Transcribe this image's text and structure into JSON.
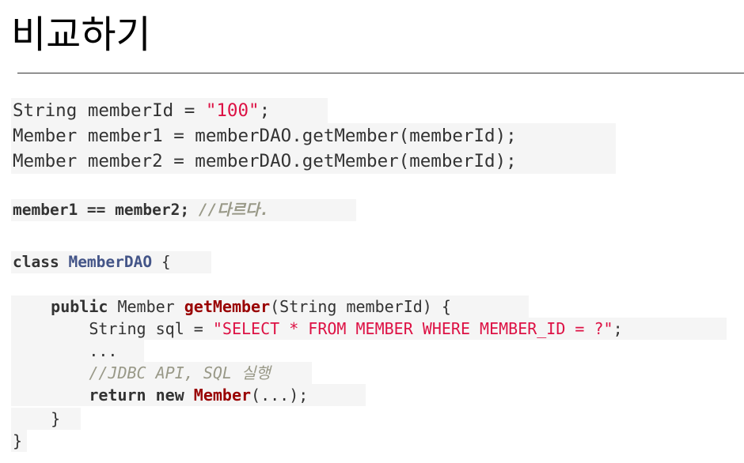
{
  "page": {
    "title": "비교하기"
  },
  "code": {
    "line1": {
      "p1": "String memberId = ",
      "s1": "\"100\"",
      "p2": ";"
    },
    "line2": {
      "p1": "Member member1 = memberDAO.getMember(memberId);"
    },
    "line3": {
      "p1": "Member member2 = memberDAO.getMember(memberId);"
    },
    "line4": {
      "p1": "member1 == member2;",
      "c1": "//다르다."
    },
    "line5": {
      "k1": "class",
      "cls": "MemberDAO",
      "p1": " {"
    },
    "line6": {
      "k1": "public",
      "p1": " Member ",
      "fn": "getMember",
      "p2": "(String memberId) {"
    },
    "line7": {
      "p1": "String sql = ",
      "s1": "\"SELECT * FROM MEMBER WHERE MEMBER_ID = ?\"",
      "p2": ";"
    },
    "line8": {
      "p1": "..."
    },
    "line9": {
      "c1": "//JDBC API, SQL 실행"
    },
    "line10": {
      "k1": "return",
      "k2": "new",
      "fn": "Member",
      "p1": "(...);"
    },
    "line11": {
      "p1": "}"
    },
    "line12": {
      "p1": "}"
    }
  },
  "colors": {
    "keyword": "#333333",
    "string": "#dd1144",
    "class_name": "#445588",
    "function_name": "#990000",
    "comment": "#999988",
    "code_background": "#f5f5f5"
  }
}
